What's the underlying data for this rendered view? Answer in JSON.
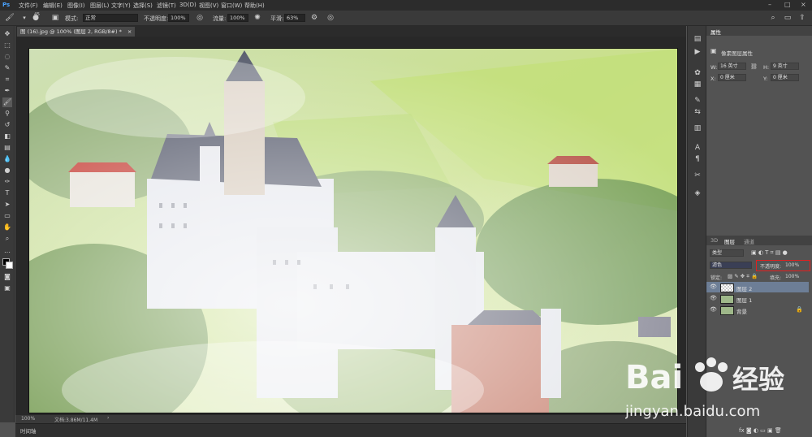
{
  "menubar": {
    "items": [
      "文件(F)",
      "编辑(E)",
      "图像(I)",
      "图层(L)",
      "文字(Y)",
      "选择(S)",
      "滤镜(T)",
      "3D(D)",
      "视图(V)",
      "窗口(W)",
      "帮助(H)"
    ],
    "window_controls": [
      "–",
      "□",
      "×"
    ]
  },
  "options": {
    "brush_size": "45",
    "mode_label": "模式:",
    "mode_value": "正常",
    "opacity_label": "不透明度:",
    "opacity_value": "100%",
    "flow_label": "流量:",
    "flow_value": "100%",
    "smooth_label": "平滑:",
    "smooth_value": "63%"
  },
  "document": {
    "tab_title": "图 (16).jpg @ 100% (图层 2, RGB/8#) *",
    "tab_close": "×"
  },
  "status": {
    "zoom": "100%",
    "doc_info": "文档:3.86M/11.4M",
    "arrow": "›"
  },
  "timeline": {
    "label": "时间轴"
  },
  "properties": {
    "title": "属性",
    "section": "像素图层属性",
    "w_label": "W:",
    "w_value": "16 英寸",
    "h_label": "H:",
    "h_value": "9 英寸",
    "x_label": "X:",
    "x_value": "0 厘米",
    "y_label": "Y:",
    "y_value": "0 厘米",
    "link_icon": "⛓"
  },
  "layers_panel": {
    "tabs": [
      "3D",
      "图层",
      "通道"
    ],
    "filter_label": "类型",
    "blend_mode": "滤色",
    "opacity_label": "不透明度:",
    "opacity_value": "100%",
    "lock_label": "锁定:",
    "fill_label": "填充:",
    "fill_value": "100%",
    "layers": [
      {
        "name": "图层 2",
        "selected": true
      },
      {
        "name": "图层 1",
        "selected": false
      },
      {
        "name": "背景",
        "selected": false
      }
    ]
  },
  "watermark": {
    "brand_text": "Bai",
    "brand_text_2": "经验",
    "url": "jingyan.baidu.com"
  },
  "colors": {
    "accent_red": "#e02020",
    "panel_bg": "#535353",
    "selected_layer": "#6d7e96"
  }
}
